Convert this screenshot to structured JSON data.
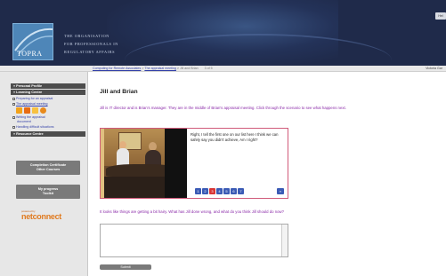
{
  "header": {
    "logo_text": "TOPRA",
    "org_lines": [
      "THE ORGANISATION",
      "FOR PROFESSIONALS IN",
      "REGULATORY AFFAIRS"
    ],
    "corner_button": "Hel"
  },
  "breadcrumb": {
    "items": [
      "Computing for Remote Associates",
      "The appraisal meeting",
      "Jill and Brian"
    ],
    "separator": " > ",
    "current_page": "3 of 5",
    "right_text": "Victoria Gar"
  },
  "sidebar": {
    "sections": [
      {
        "label": "» Personal Profile"
      },
      {
        "label": "» Learning Centre"
      }
    ],
    "items": [
      {
        "label": "Preparing for an appraisal"
      },
      {
        "label": "The appraisal meeting"
      },
      {
        "label": "Writing the appraisal"
      },
      {
        "label": "document"
      },
      {
        "label": "Handling difficult situations"
      }
    ],
    "resource_centre": "» Resource Centre",
    "completion_button": [
      "Completion Certificate",
      "Other Courses"
    ],
    "progress_button": [
      "My progress",
      "Toolkit"
    ],
    "powered_by": "powered by",
    "brand": "netconnect"
  },
  "main": {
    "title": "Jill and Brian",
    "intro": "Jill is IT director and is Brian's manager. They are in the middle of Brian's appraisal meeting. Click through the scenario to see what happens next.",
    "scenario": {
      "speech": "Right, I tell the first one on our list here I think we can safely say you didn't achieve, Am I right?",
      "pages": [
        "1",
        "2",
        "3",
        "4",
        "5",
        "6",
        "7"
      ],
      "current_page_index": 2,
      "next_label": "»"
    },
    "question": "It looks like things are getting a bit hairy. What has Jill done wrong, and what do you think Jill should do now?",
    "answer_value": "",
    "submit_label": "Submit"
  },
  "colors": {
    "header_bg": "#1f2a4a",
    "link": "#3340a8",
    "prompt_text": "#8a2aa8",
    "scenario_border": "#d05a7a",
    "pager": "#3b5bb5",
    "pager_current": "#d93636",
    "brand": "#e07a1f"
  }
}
